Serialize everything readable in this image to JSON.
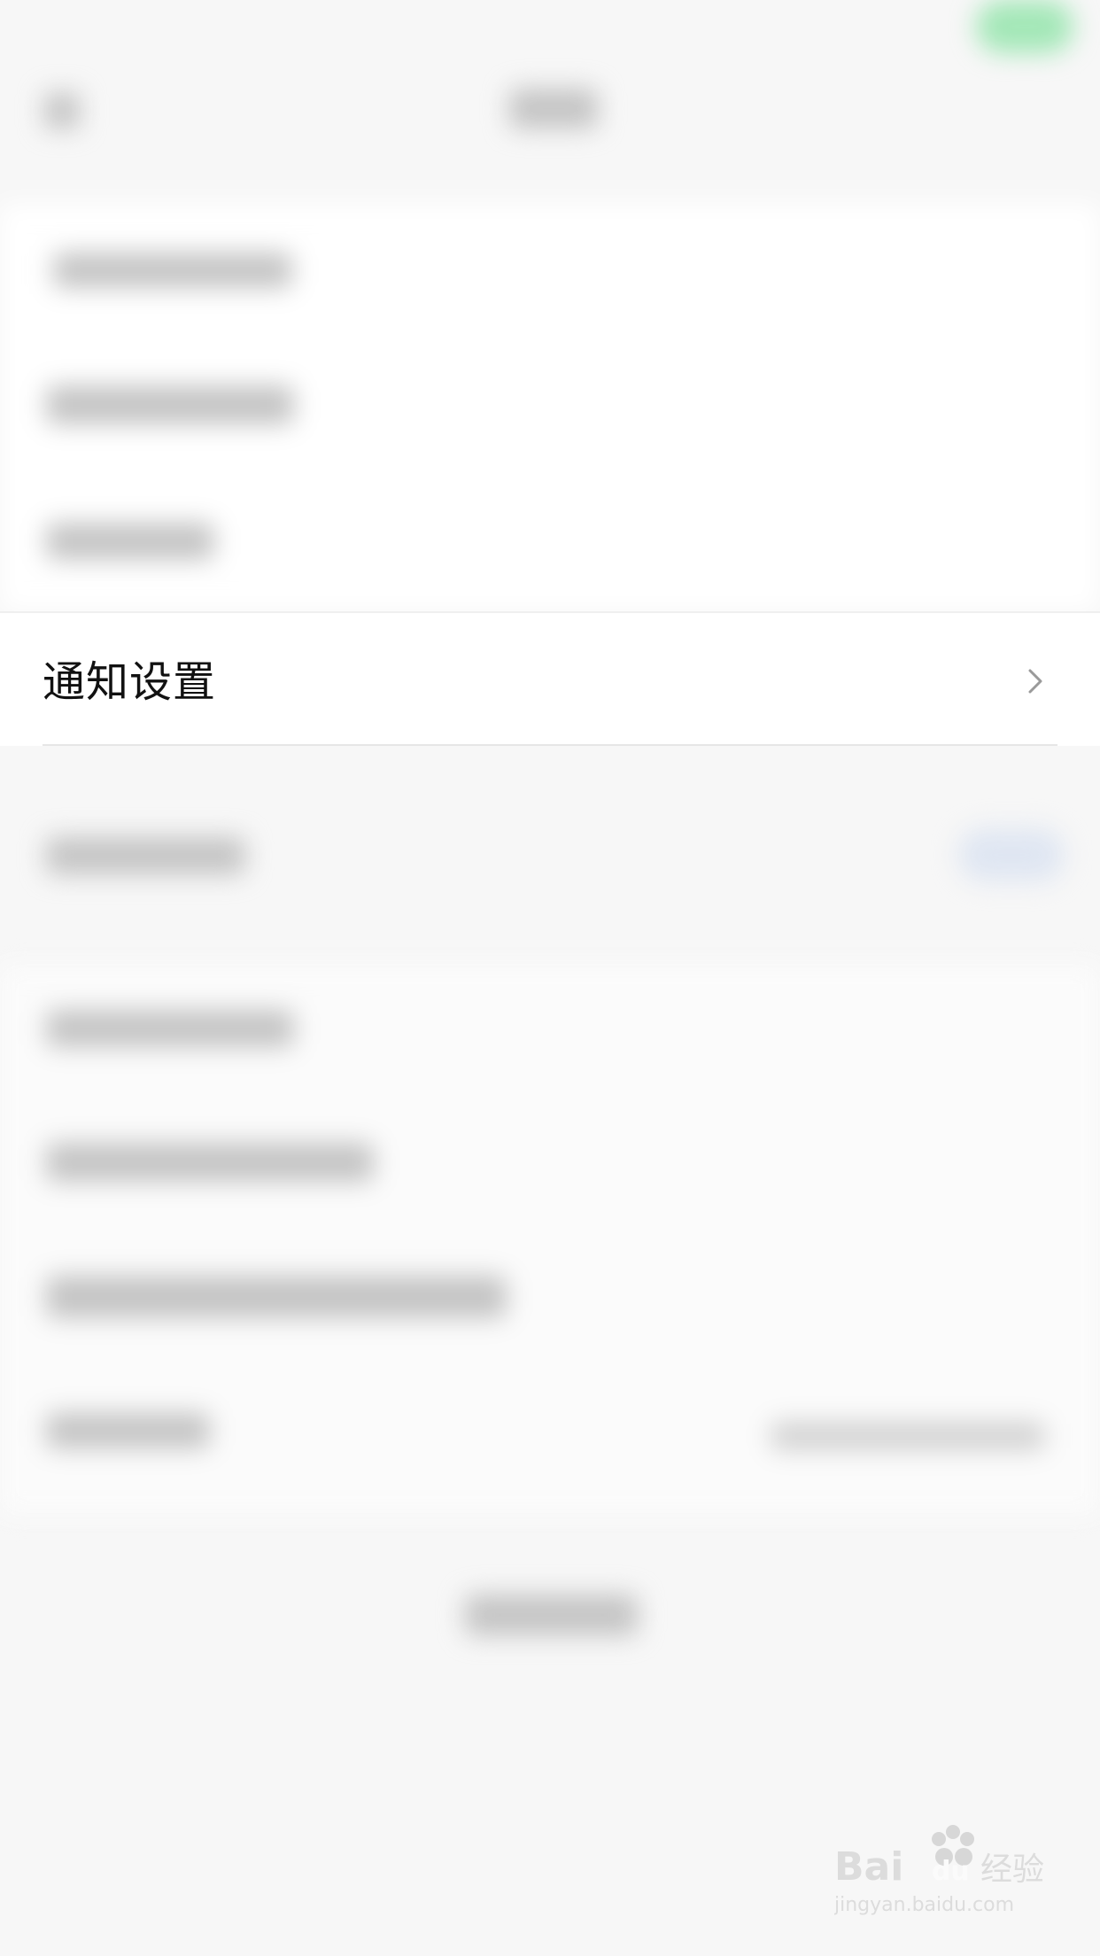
{
  "focused_item": {
    "label": "通知设置",
    "chevron_icon": "chevron-right-icon"
  },
  "watermark": {
    "brand": "Baidu经验",
    "domain": "jingyan.baidu.com"
  },
  "colors": {
    "background": "#f7f7f7",
    "panel": "#ffffff",
    "accent_green": "#8fe3a8",
    "text": "#111111",
    "chevron": "#9a9a9a"
  }
}
